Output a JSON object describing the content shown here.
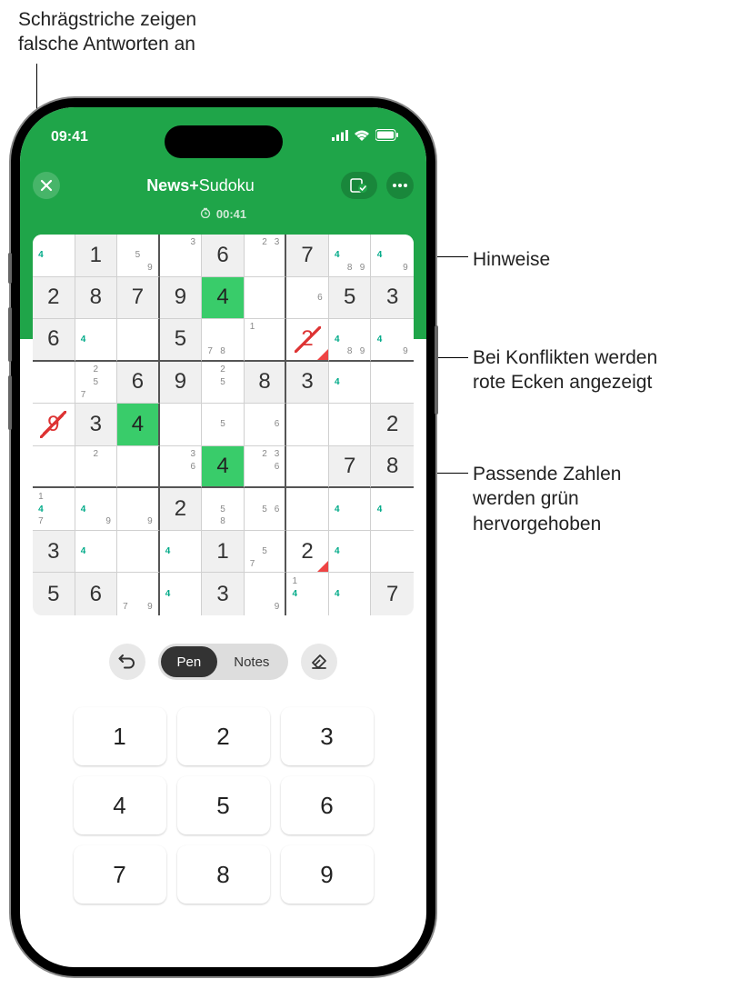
{
  "annotations": {
    "slash": "Schrägstriche zeigen\nfalsche Antworten an",
    "hints": "Hinweise",
    "conflict": "Bei Konflikten werden\nrote Ecken angezeigt",
    "match": "Passende Zahlen\nwerden grün\nhervorgehoben"
  },
  "status": {
    "time": "09:41"
  },
  "nav": {
    "apple_news": "News+",
    "title_suffix": " Sudoku"
  },
  "timer": "00:41",
  "toolbar": {
    "pen": "Pen",
    "notes": "Notes"
  },
  "keypad": [
    "1",
    "2",
    "3",
    "4",
    "5",
    "6",
    "7",
    "8",
    "9"
  ],
  "board": [
    [
      {
        "notes": [
          null,
          null,
          null,
          "4",
          null,
          null,
          null,
          null,
          null
        ],
        "hl": [
          3
        ]
      },
      {
        "v": "1",
        "given": true
      },
      {
        "notes": [
          null,
          null,
          null,
          null,
          "5",
          null,
          null,
          null,
          "9"
        ]
      },
      {
        "notes": [
          null,
          null,
          "3",
          null,
          null,
          null,
          null,
          null,
          null
        ]
      },
      {
        "v": "6",
        "given": true
      },
      {
        "notes": [
          null,
          "2",
          "3",
          null,
          null,
          null,
          null,
          null,
          null
        ]
      },
      {
        "v": "7",
        "given": true
      },
      {
        "notes": [
          null,
          null,
          null,
          "4",
          null,
          null,
          null,
          "8",
          "9"
        ],
        "hl": [
          3
        ]
      },
      {
        "notes": [
          null,
          null,
          null,
          "4",
          null,
          null,
          null,
          null,
          "9"
        ],
        "hl": [
          3
        ]
      }
    ],
    [
      {
        "v": "2",
        "given": true
      },
      {
        "v": "8",
        "given": true
      },
      {
        "v": "7",
        "given": true
      },
      {
        "v": "9",
        "given": true
      },
      {
        "v": "4",
        "sel": true
      },
      {
        "notes": [
          null,
          null,
          null,
          null,
          null,
          null,
          null,
          null,
          null
        ]
      },
      {
        "notes": [
          null,
          null,
          null,
          null,
          null,
          "6",
          null,
          null,
          null
        ]
      },
      {
        "v": "5",
        "given": true
      },
      {
        "v": "3",
        "given": true
      }
    ],
    [
      {
        "v": "6",
        "given": true
      },
      {
        "notes": [
          null,
          null,
          null,
          "4",
          null,
          null,
          null,
          null,
          null
        ],
        "hl": [
          3
        ]
      },
      {
        "notes": [
          null,
          null,
          null,
          null,
          null,
          null,
          null,
          null,
          null
        ]
      },
      {
        "v": "5",
        "given": true
      },
      {
        "notes": [
          null,
          null,
          null,
          null,
          null,
          null,
          "7",
          "8",
          null
        ]
      },
      {
        "notes": [
          "1",
          null,
          null,
          null,
          null,
          null,
          null,
          null,
          null
        ]
      },
      {
        "v": "2",
        "wrong": true,
        "flag": true
      },
      {
        "notes": [
          null,
          null,
          null,
          "4",
          null,
          null,
          null,
          "8",
          "9"
        ],
        "hl": [
          3
        ]
      },
      {
        "notes": [
          null,
          null,
          null,
          "4",
          null,
          null,
          null,
          null,
          "9"
        ],
        "hl": [
          3
        ]
      }
    ],
    [
      {
        "notes": [
          null,
          null,
          null,
          null,
          null,
          null,
          null,
          null,
          null
        ]
      },
      {
        "notes": [
          null,
          "2",
          null,
          null,
          "5",
          null,
          "7",
          null,
          null
        ]
      },
      {
        "v": "6",
        "given": true
      },
      {
        "v": "9",
        "given": true
      },
      {
        "notes": [
          null,
          "2",
          null,
          null,
          "5",
          null,
          null,
          null,
          null
        ]
      },
      {
        "v": "8",
        "given": true
      },
      {
        "v": "3",
        "given": true
      },
      {
        "notes": [
          null,
          null,
          null,
          "4",
          null,
          null,
          null,
          null,
          null
        ],
        "hl": [
          3
        ]
      },
      {
        "notes": [
          null,
          null,
          null,
          null,
          null,
          null,
          null,
          null,
          null
        ]
      }
    ],
    [
      {
        "v": "9",
        "wrong": true
      },
      {
        "v": "3",
        "given": true
      },
      {
        "v": "4",
        "sel": true
      },
      {
        "notes": [
          null,
          null,
          null,
          null,
          null,
          null,
          null,
          null,
          null
        ]
      },
      {
        "notes": [
          null,
          null,
          null,
          null,
          "5",
          null,
          null,
          null,
          null
        ]
      },
      {
        "notes": [
          null,
          null,
          null,
          null,
          null,
          "6",
          null,
          null,
          null
        ]
      },
      {
        "notes": [
          null,
          null,
          null,
          null,
          null,
          null,
          null,
          null,
          null
        ]
      },
      {
        "notes": [
          null,
          null,
          null,
          null,
          null,
          null,
          null,
          null,
          null
        ]
      },
      {
        "v": "2",
        "given": true
      }
    ],
    [
      {
        "notes": [
          null,
          null,
          null,
          null,
          null,
          null,
          null,
          null,
          null
        ]
      },
      {
        "notes": [
          null,
          "2",
          null,
          null,
          null,
          null,
          null,
          null,
          null
        ]
      },
      {
        "notes": [
          null,
          null,
          null,
          null,
          null,
          null,
          null,
          null,
          null
        ]
      },
      {
        "notes": [
          null,
          null,
          "3",
          null,
          null,
          "6",
          null,
          null,
          null
        ]
      },
      {
        "v": "4",
        "sel": true
      },
      {
        "notes": [
          null,
          "2",
          "3",
          null,
          null,
          "6",
          null,
          null,
          null
        ]
      },
      {
        "notes": [
          null,
          null,
          null,
          null,
          null,
          null,
          null,
          null,
          null
        ]
      },
      {
        "v": "7",
        "given": true
      },
      {
        "v": "8",
        "given": true
      }
    ],
    [
      {
        "notes": [
          "1",
          null,
          null,
          "4",
          null,
          null,
          "7",
          null,
          null
        ],
        "hl": [
          3
        ]
      },
      {
        "notes": [
          null,
          null,
          null,
          "4",
          null,
          null,
          null,
          null,
          "9"
        ],
        "hl": [
          3
        ]
      },
      {
        "notes": [
          null,
          null,
          null,
          null,
          null,
          null,
          null,
          null,
          "9"
        ]
      },
      {
        "v": "2",
        "given": true
      },
      {
        "notes": [
          null,
          null,
          null,
          null,
          "5",
          null,
          null,
          "8",
          null
        ]
      },
      {
        "notes": [
          null,
          null,
          null,
          null,
          "5",
          "6",
          null,
          null,
          null
        ]
      },
      {
        "notes": [
          null,
          null,
          null,
          null,
          null,
          null,
          null,
          null,
          null
        ]
      },
      {
        "notes": [
          null,
          null,
          null,
          "4",
          null,
          null,
          null,
          null,
          null
        ],
        "hl": [
          3
        ]
      },
      {
        "notes": [
          null,
          null,
          null,
          "4",
          null,
          null,
          null,
          null,
          null
        ],
        "hl": [
          3
        ]
      }
    ],
    [
      {
        "v": "3",
        "given": true
      },
      {
        "notes": [
          null,
          null,
          null,
          "4",
          null,
          null,
          null,
          null,
          null
        ],
        "hl": [
          3
        ]
      },
      {
        "notes": [
          null,
          null,
          null,
          null,
          null,
          null,
          null,
          null,
          null
        ]
      },
      {
        "notes": [
          null,
          null,
          null,
          "4",
          null,
          null,
          null,
          null,
          null
        ],
        "hl": [
          3
        ]
      },
      {
        "v": "1",
        "given": true
      },
      {
        "notes": [
          null,
          null,
          null,
          null,
          "5",
          null,
          "7",
          null,
          null
        ]
      },
      {
        "v": "2",
        "flag": true
      },
      {
        "notes": [
          null,
          null,
          null,
          "4",
          null,
          null,
          null,
          null,
          null
        ],
        "hl": [
          3
        ]
      },
      {
        "notes": [
          null,
          null,
          null,
          null,
          null,
          null,
          null,
          null,
          null
        ]
      }
    ],
    [
      {
        "v": "5",
        "given": true
      },
      {
        "v": "6",
        "given": true
      },
      {
        "notes": [
          null,
          null,
          null,
          null,
          null,
          null,
          "7",
          null,
          "9"
        ]
      },
      {
        "notes": [
          null,
          null,
          null,
          "4",
          null,
          null,
          null,
          null,
          null
        ],
        "hl": [
          3
        ]
      },
      {
        "v": "3",
        "given": true
      },
      {
        "notes": [
          null,
          null,
          null,
          null,
          null,
          null,
          null,
          null,
          "9"
        ]
      },
      {
        "notes": [
          "1",
          null,
          null,
          "4",
          null,
          null,
          null,
          null,
          null
        ],
        "hl": [
          3
        ]
      },
      {
        "notes": [
          null,
          null,
          null,
          "4",
          null,
          null,
          null,
          null,
          null
        ],
        "hl": [
          3
        ]
      },
      {
        "v": "7",
        "given": true
      }
    ]
  ]
}
